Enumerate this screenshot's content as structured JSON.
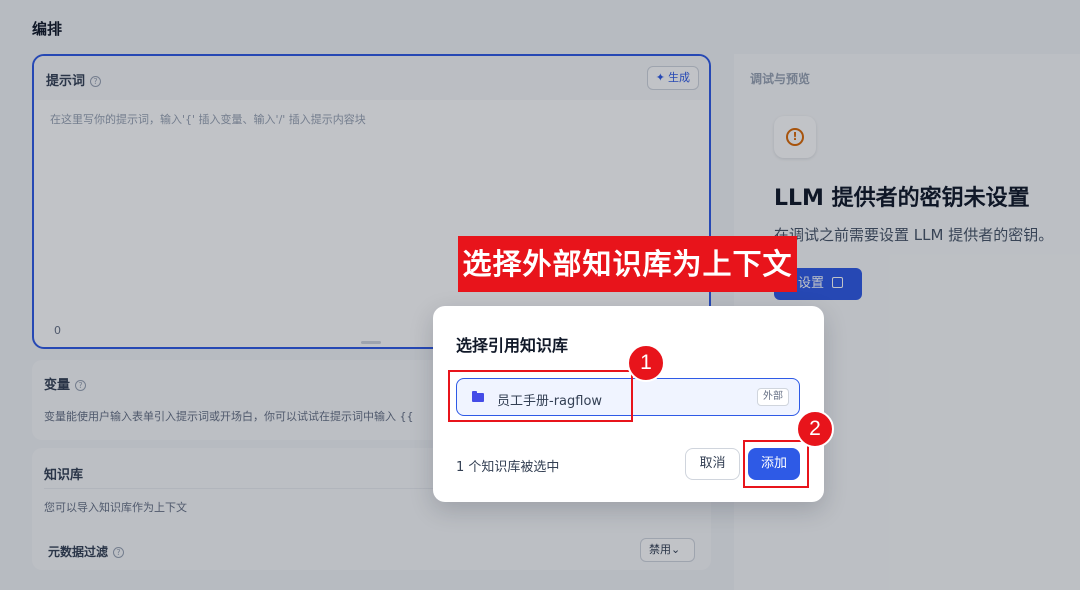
{
  "page": {
    "title": "编排"
  },
  "prompt": {
    "title": "提示词",
    "help": "?",
    "generate_icon": "sparkle-icon",
    "generate_label": "生成",
    "placeholder": "在这里写你的提示词，输入'{' 插入变量、输入'/' 插入提示内容块",
    "char_count": "0"
  },
  "variables": {
    "title": "变量",
    "help": "?",
    "description": "变量能使用户输入表单引入提示词或开场白，你可以试试在提示词中输入 {{"
  },
  "knowledge": {
    "title": "知识库",
    "description": "您可以导入知识库作为上下文",
    "metadata_filter_label": "元数据过滤",
    "help": "?",
    "metadata_filter_value": "禁用",
    "chevron": "⌄"
  },
  "right_panel": {
    "debug_title": "调试与预览",
    "warning_icon": "info-circle-icon",
    "warning_symbol": "!",
    "llm_title": "LLM 提供者的密钥未设置",
    "llm_description": "在调试之前需要设置 LLM 提供者的密钥。",
    "settings_label": "设置",
    "settings_icon": "external-link-icon"
  },
  "annotation": {
    "banner": "选择外部知识库为上下文",
    "step1": "1",
    "step2": "2",
    "color": "#e8141b"
  },
  "modal": {
    "title": "选择引用知识库",
    "items": [
      {
        "icon": "folder-icon",
        "name": "员工手册-ragflow",
        "tag": "外部"
      }
    ],
    "selected_count": "1 个知识库被选中",
    "cancel_label": "取消",
    "add_label": "添加"
  },
  "colors": {
    "accent": "#2e5ae6",
    "warning": "#dc6803"
  }
}
